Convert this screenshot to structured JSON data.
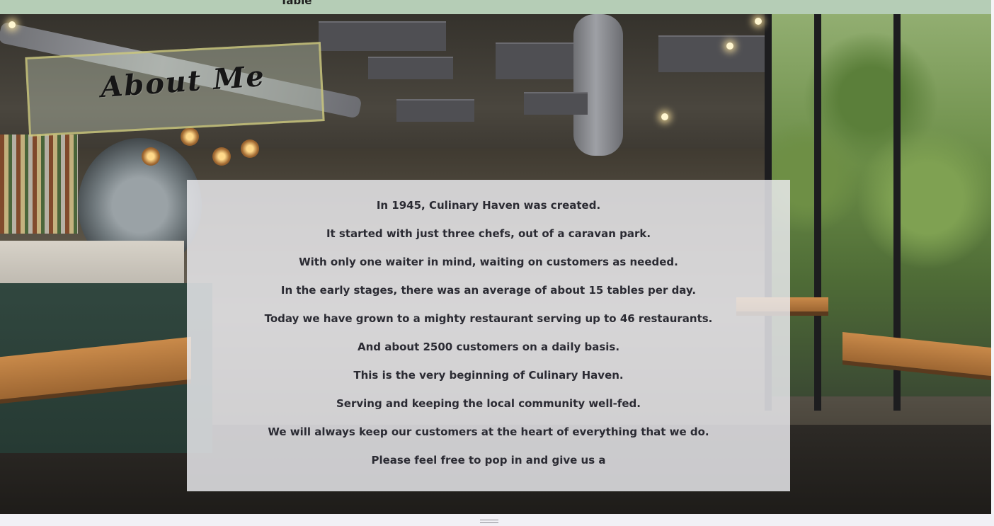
{
  "topbar": {
    "label": "Table"
  },
  "hero": {
    "title": "About Me"
  },
  "story": {
    "lines": [
      "In 1945, Culinary Haven was created.",
      "It started with just three chefs, out of a caravan park.",
      "With only one waiter in mind, waiting on customers as needed.",
      "In the early stages, there was an average of about 15 tables per day.",
      "Today we have grown to a mighty restaurant serving up to 46 restaurants.",
      "And about 2500 customers on a daily basis.",
      "This is the very beginning of Culinary Haven.",
      "Serving and keeping the local community well-fed.",
      "We will always keep our customers at the heart of everything that we do.",
      "Please feel free to pop in and give us a"
    ]
  },
  "colors": {
    "topbar": "#b5cdb6",
    "card": "#ebebee",
    "text": "#2b2b33",
    "banner_border": "#cdc878"
  },
  "icons": {
    "resize_handle": "grip-lines-icon"
  }
}
